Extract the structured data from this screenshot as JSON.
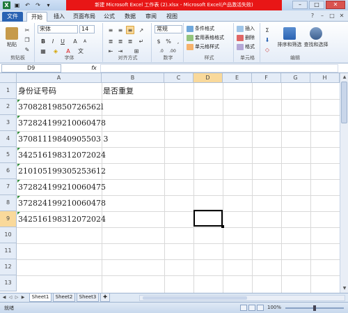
{
  "app": {
    "title": "新建 Microsoft Excel 工作表 (2).xlsx - Microsoft Excel(产品激活失败)",
    "window_controls": [
      "–",
      "□",
      "✕"
    ]
  },
  "ribbon_tabs": [
    "文件",
    "开始",
    "插入",
    "页面布局",
    "公式",
    "数据",
    "审阅",
    "视图"
  ],
  "ribbon": {
    "paste_label": "粘贴",
    "font_name": "宋体",
    "font_size": "14",
    "number_format": "常规",
    "groups": [
      "剪贴板",
      "字体",
      "对齐方式",
      "数字",
      "样式",
      "单元格",
      "编辑"
    ],
    "styles": [
      "条件格式",
      "套用表格格式",
      "单元格样式"
    ],
    "cells": [
      "插入",
      "删除",
      "格式"
    ],
    "editing": [
      "排序和筛选",
      "查找和选择"
    ]
  },
  "formula_bar": {
    "name_box": "D9",
    "fx": "fx",
    "content": ""
  },
  "sheet": {
    "columns": [
      "A",
      "B",
      "C",
      "D",
      "E",
      "F",
      "G",
      "H"
    ],
    "selected_column": "D",
    "selected_row": "9",
    "rows": [
      "1",
      "2",
      "3",
      "4",
      "5",
      "6",
      "7",
      "8",
      "9",
      "10",
      "11",
      "12",
      "13"
    ],
    "col_a": [
      "身份证号码",
      "37082819850726562l",
      "372824199210060478",
      "37081119840905503 3",
      "342516198312072024",
      "210105199305253612",
      "372824199210060475",
      "372824199210060478",
      "342516198312072024"
    ],
    "col_b_header": "是否重复"
  },
  "sheet_tabs": [
    "Sheet1",
    "Sheet2",
    "Sheet3"
  ],
  "status": {
    "ready": "就绪",
    "zoom": "100%"
  }
}
